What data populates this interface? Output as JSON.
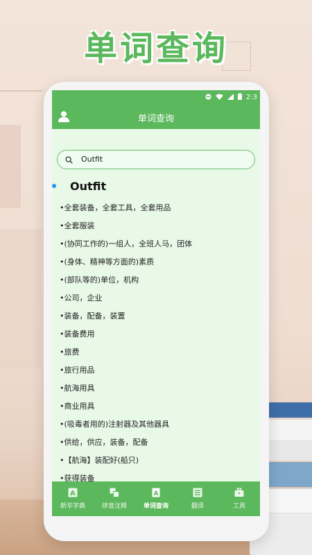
{
  "banner": {
    "title": "单词查询"
  },
  "status": {
    "time": "2:3"
  },
  "appbar": {
    "title": "单词查询"
  },
  "search": {
    "value": "Outfit"
  },
  "word": {
    "headword": "Outfit"
  },
  "definitions": [
    "•全套装备，全套工具，全套用品",
    "•全套服装",
    "•(协同工作的)一组人，全班人马，团体",
    "•(身体、精神等方面的)素质",
    "•(部队等的)单位，机构",
    "•公司，企业",
    "•装备，配备，装置",
    "•装备费用",
    "•旅费",
    "•旅行用品",
    "•航海用具",
    "•商业用具",
    "•(吸毒者用的)注射器及其他器具",
    "•供给，供应，装备，配备",
    "•【航海】装配好(船只)",
    "•获得装备"
  ],
  "tabs": [
    {
      "label": "新华字典",
      "icon": "dictionary-icon"
    },
    {
      "label": "拼音注释",
      "icon": "pinyin-icon"
    },
    {
      "label": "单词查询",
      "icon": "word-lookup-icon",
      "active": true
    },
    {
      "label": "翻译",
      "icon": "translate-icon"
    },
    {
      "label": "工具",
      "icon": "toolbox-icon"
    }
  ],
  "colors": {
    "primary": "#5cb85c",
    "screen_bg": "#e8f9e8",
    "accent_dot": "#2196f3"
  }
}
